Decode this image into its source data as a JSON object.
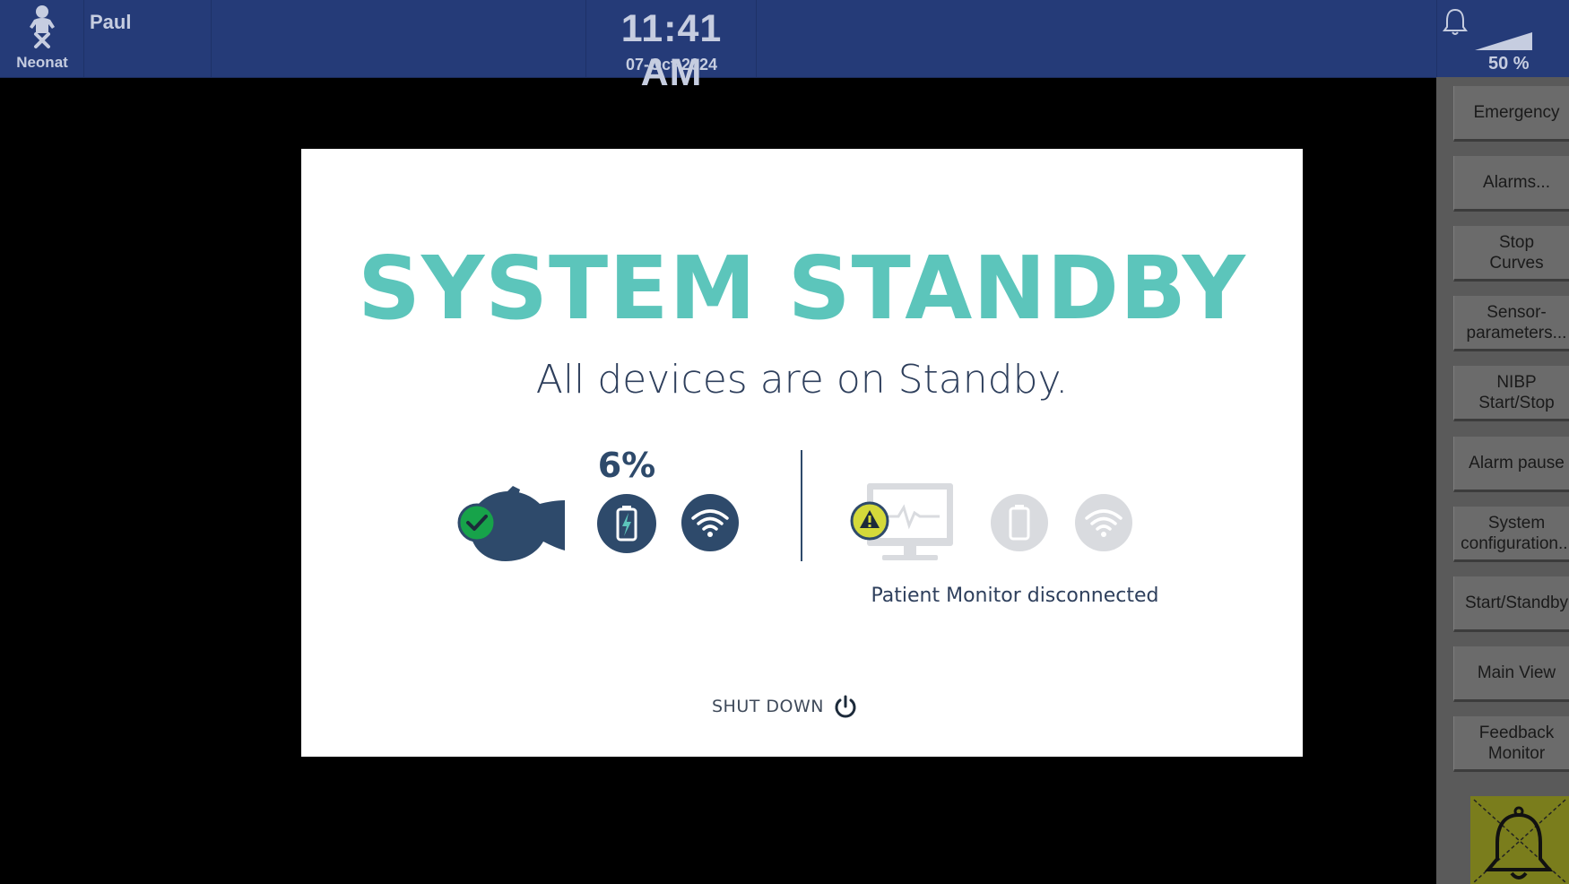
{
  "header": {
    "patient_type": "Neonat",
    "patient_name": "Paul",
    "time": "11:41 AM",
    "date": "07-Oct-2024",
    "volume": "50 %",
    "icons": [
      "baby-icon",
      "bell-icon",
      "volume-icon"
    ]
  },
  "sidebar": {
    "buttons": [
      {
        "label": "Emergency"
      },
      {
        "label": "Alarms..."
      },
      {
        "label": "Stop\nCurves"
      },
      {
        "label": "Sensor-\nparameters..."
      },
      {
        "label": "NIBP\nStart/Stop"
      },
      {
        "label": "Alarm pause"
      },
      {
        "label": "System\nconfiguration..."
      },
      {
        "label": "Start/Standby"
      },
      {
        "label": "Main View"
      },
      {
        "label": "Feedback\nMonitor"
      }
    ],
    "alarm_off_icon": "alarm-off-bell-icon",
    "alarm_off_color": "#7a7d1c"
  },
  "dialog": {
    "title": "SYSTEM STANDBY",
    "subtitle": "All devices are on Standby.",
    "device": {
      "battery_percent": "6%",
      "status": "connected",
      "icons": [
        "baby-head-icon",
        "check-badge-icon",
        "battery-charging-icon",
        "wifi-icon"
      ]
    },
    "monitor": {
      "status_text": "Patient Monitor disconnected",
      "icons": [
        "monitor-icon",
        "warning-badge-icon",
        "battery-icon",
        "wifi-icon"
      ]
    },
    "shutdown_label": "SHUT DOWN",
    "shutdown_icon": "power-icon"
  },
  "colors": {
    "header_bg": "#253b78",
    "title": "#5cc5bb",
    "device_navy": "#2e4a6b",
    "ok_green": "#17a34a",
    "warn_yellow": "#d4d93a",
    "disabled_gray": "#d9dbdf",
    "sidebar_bg": "#5a5a5a"
  }
}
